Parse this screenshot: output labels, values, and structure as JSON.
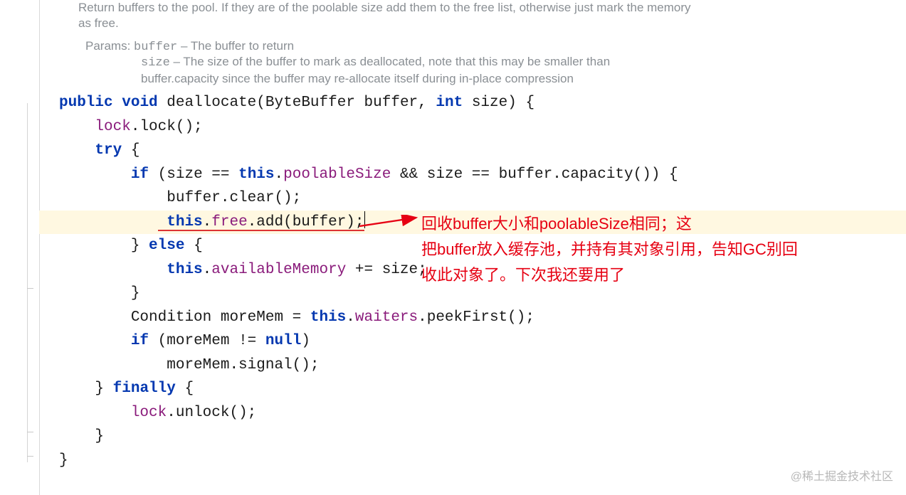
{
  "javadoc": {
    "summary": "Return buffers to the pool. If they are of the poolable size add them to the free list, otherwise just mark the memory as free.",
    "params_label": "Params:",
    "param_buffer_name": "buffer",
    "param_buffer_desc": "– The buffer to return",
    "param_size_name": "size",
    "param_size_desc": "– The size of the buffer to mark as deallocated, note that this may be smaller than buffer.capacity since the buffer may re-allocate itself during in-place compression"
  },
  "kw": {
    "public": "public",
    "void": "void",
    "try": "try",
    "if": "if",
    "else": "else",
    "this": "this",
    "null": "null",
    "finally": "finally",
    "int": "int"
  },
  "code": {
    "method_name": "deallocate",
    "param1_type": "ByteBuffer",
    "param1_name": "buffer",
    "param2_name": "size",
    "lock_field": "lock",
    "lock_call": ".lock();",
    "poolableSize": "poolableSize",
    "bufcap": "buffer.capacity()) {",
    "buffer_clear": "buffer.clear();",
    "free_field": "free",
    "add_call": ".add(buffer);",
    "availMem": "availableMemory",
    "plus_size": " += size;",
    "cond_decl": "Condition moreMem = ",
    "waiters": "waiters",
    "peek": ".peekFirst();",
    "signal": "moreMem.signal();",
    "moreMemCheck": "moreMem != ",
    "unlock": ".unlock();",
    "open_brace": "{",
    "close_brace": "}",
    "open_paren": "(",
    "close_paren": ")",
    "close_paren_brace": ") {",
    "comma_sp": ", ",
    "size_eq": " && size == ",
    "size_eq2": "size == ",
    "dot": "."
  },
  "annotation": {
    "line1": "回收buffer大小和poolableSize相同；这",
    "line2": "把buffer放入缓存池，并持有其对象引用，告知GC别回",
    "line3": "收此对象了。下次我还要用了"
  },
  "watermark": "@稀土掘金技术社区"
}
